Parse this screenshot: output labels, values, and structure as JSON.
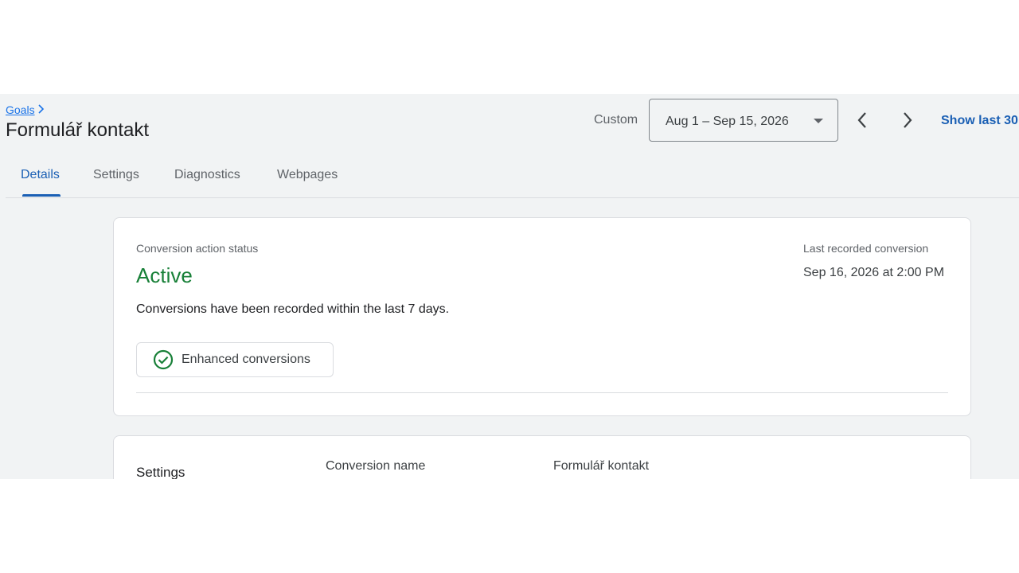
{
  "breadcrumb": {
    "parent": "Goals"
  },
  "page": {
    "title": "Formulář kontakt"
  },
  "date_range": {
    "label": "Custom",
    "value": "Aug 1 – Sep 15, 2026",
    "show_last": "Show last 30"
  },
  "tabs": [
    {
      "label": "Details",
      "active": true
    },
    {
      "label": "Settings",
      "active": false
    },
    {
      "label": "Diagnostics",
      "active": false
    },
    {
      "label": "Webpages",
      "active": false
    }
  ],
  "status_card": {
    "status_label": "Conversion action status",
    "status_value": "Active",
    "description": "Conversions have been recorded within the last 7 days.",
    "chip_label": "Enhanced conversions",
    "last_label": "Last recorded conversion",
    "last_value": "Sep 16, 2026 at 2:00 PM"
  },
  "settings_card": {
    "heading": "Settings",
    "rows": [
      {
        "name": "Conversion name",
        "value": "Formulář kontakt"
      }
    ]
  },
  "colors": {
    "accent": "#1a5fb4",
    "status_active": "#188038",
    "background": "#f1f3f4"
  },
  "icons": {
    "breadcrumb": "chevron-right-icon",
    "dropdown": "caret-down-icon",
    "prev": "chevron-left-icon",
    "next": "chevron-right-icon",
    "chip": "check-circle-icon"
  }
}
